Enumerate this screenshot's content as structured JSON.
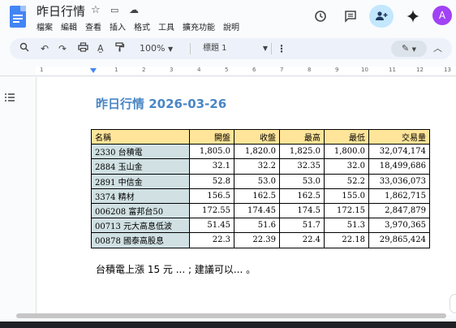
{
  "doc": {
    "title": "昨日行情",
    "menu": [
      "檔案",
      "編輯",
      "查看",
      "插入",
      "格式",
      "工具",
      "擴充功能",
      "說明"
    ],
    "avatar_letter": "A"
  },
  "toolbar": {
    "zoom": "100%",
    "paragraph_style": "標題 1"
  },
  "ruler": {
    "labels": [
      "1",
      "1",
      "2",
      "3",
      "4",
      "5",
      "6",
      "7",
      "8",
      "9",
      "10",
      "11",
      "12",
      "13",
      "14"
    ]
  },
  "content": {
    "heading": "昨日行情 2026-03-26",
    "table": {
      "headers": [
        "名稱",
        "開盤",
        "收盤",
        "最高",
        "最低",
        "交易量"
      ],
      "rows": [
        [
          "2330 台積電",
          "1,805.0",
          "1,820.0",
          "1,825.0",
          "1,800.0",
          "32,074,174"
        ],
        [
          "2884 玉山金",
          "32.1",
          "32.2",
          "32.35",
          "32.0",
          "18,499,686"
        ],
        [
          "2891 中信金",
          "52.8",
          "53.0",
          "53.0",
          "52.2",
          "33,036,073"
        ],
        [
          "3374 精材",
          "156.5",
          "162.5",
          "162.5",
          "155.0",
          "1,862,715"
        ],
        [
          "006208 富邦台50",
          "172.55",
          "174.45",
          "174.5",
          "172.15",
          "2,847,879"
        ],
        [
          "00713 元大高息低波",
          "51.45",
          "51.6",
          "51.7",
          "51.3",
          "3,970,365"
        ],
        [
          "00878 國泰高股息",
          "22.3",
          "22.39",
          "22.4",
          "22.18",
          "29,865,424"
        ]
      ]
    },
    "paragraph": "台積電上漲 15 元 ... ; 建議可以... 。"
  },
  "icons": {
    "star": "star-icon",
    "move": "move-to-folder-icon",
    "cloud": "cloud-status-icon",
    "history": "version-history-icon",
    "comments": "comments-icon",
    "share": "share-icon",
    "gemini": "gemini-icon"
  },
  "colors": {
    "heading": "#4a86c5",
    "header_fill": "#ffe599",
    "name_fill": "#d0e0e3",
    "accent": "#4285f4"
  }
}
